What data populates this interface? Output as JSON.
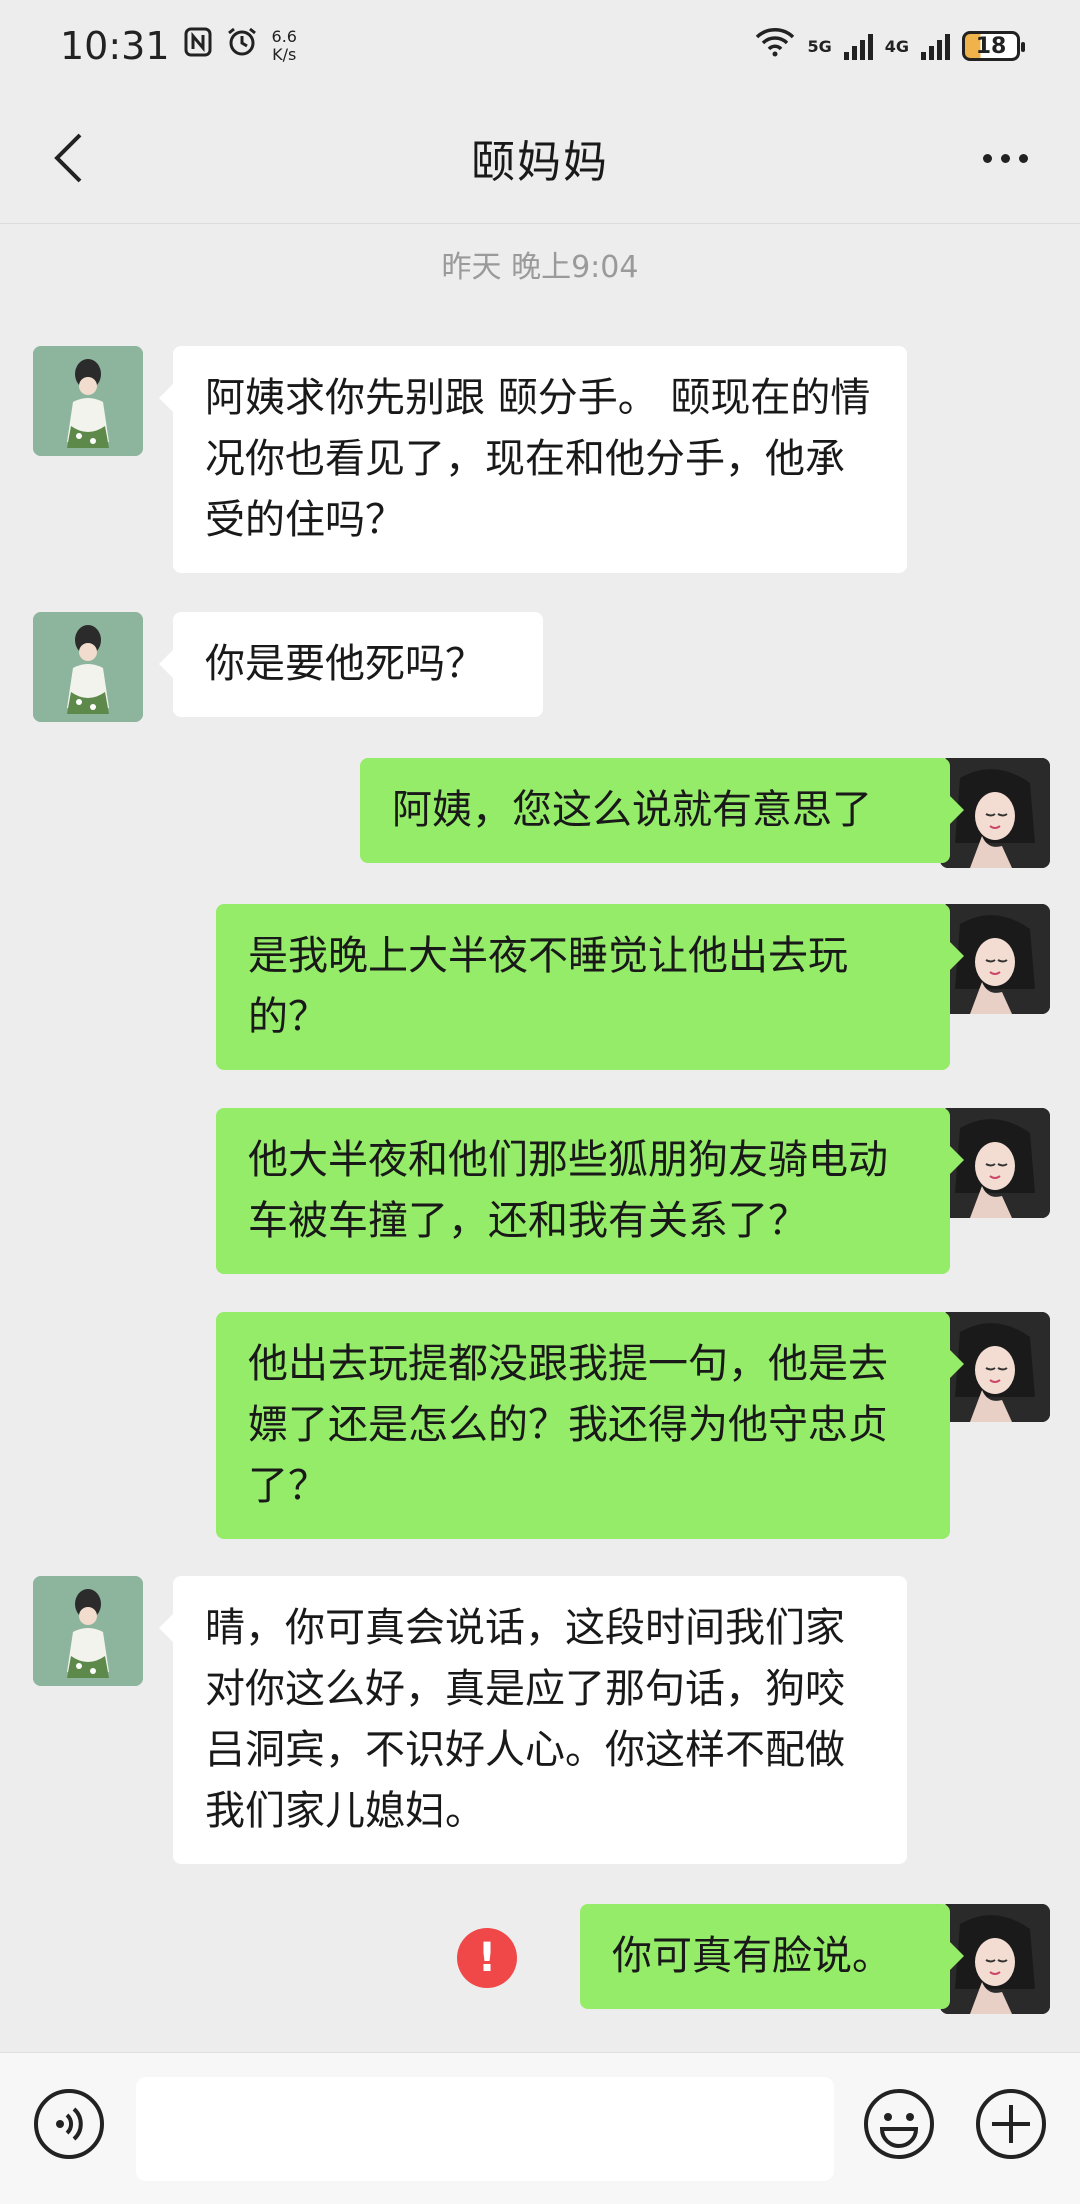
{
  "status_bar": {
    "time": "10:31",
    "speed_value": "6.6",
    "speed_unit": "K/s",
    "net1": "5G",
    "net2": "4G",
    "battery": "18"
  },
  "header": {
    "title": "颐妈妈"
  },
  "timestamp": "昨天 晚上9:04",
  "messages": [
    {
      "side": "left",
      "text": "阿姨求你先别跟 颐分手。 颐现在的情况你也看见了，现在和他分手，他承受的住吗？"
    },
    {
      "side": "left",
      "text": "你是要他死吗？"
    },
    {
      "side": "right",
      "text": "阿姨，您这么说就有意思了"
    },
    {
      "side": "right",
      "text": "是我晚上大半夜不睡觉让他出去玩的？"
    },
    {
      "side": "right",
      "text": "他大半夜和他们那些狐朋狗友骑电动车被车撞了，还和我有关系了？"
    },
    {
      "side": "right",
      "text": "他出去玩提都没跟我提一句，他是去嫖了还是怎么的？我还得为他守忠贞了？"
    },
    {
      "side": "left",
      "text": "晴，你可真会说话，这段时间我们家对你这么好，真是应了那句话，狗咬吕洞宾，不识好人心。你这样不配做我们家儿媳妇。"
    },
    {
      "side": "right",
      "text": "你可真有脸说。",
      "failed": true,
      "error_mark": "!"
    }
  ],
  "input": {
    "value": "",
    "placeholder": ""
  },
  "colors": {
    "background": "#ededed",
    "bubble_self": "#95ec69",
    "bubble_other": "#ffffff",
    "error": "#f04848"
  }
}
